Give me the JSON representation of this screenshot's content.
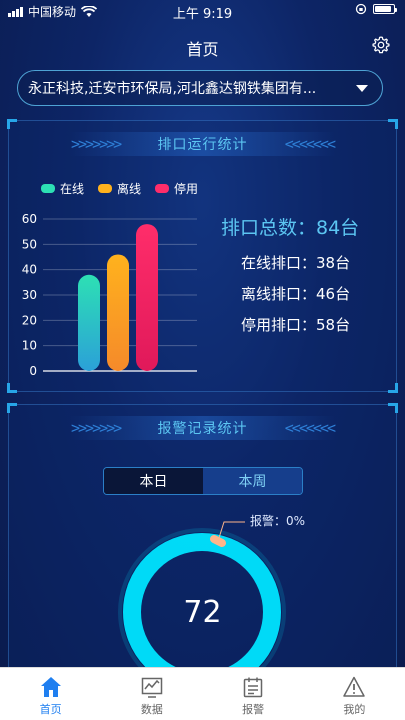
{
  "status_bar": {
    "carrier": "中国移动",
    "time": "上午 9:19"
  },
  "header": {
    "title": "首页"
  },
  "icons": {
    "settings": "gear-icon",
    "dropdown": "caret-down-icon"
  },
  "selector": {
    "value": "永正科技,迁安市环保局,河北鑫达钢铁集团有..."
  },
  "outlet_panel": {
    "title": "排口运行统计",
    "total_label": "排口总数：84台",
    "online_label": "在线排口：38台",
    "offline_label": "离线排口：46台",
    "stopped_label": "停用排口：58台"
  },
  "chart_data": {
    "type": "bar",
    "categories": [
      "在线",
      "离线",
      "停用"
    ],
    "series": [
      {
        "name": "在线",
        "values": [
          38
        ]
      },
      {
        "name": "离线",
        "values": [
          46
        ]
      },
      {
        "name": "停用",
        "values": [
          58
        ]
      }
    ],
    "values": [
      38,
      46,
      58
    ],
    "yticks": [
      "0",
      "10",
      "20",
      "30",
      "40",
      "50",
      "60"
    ],
    "ylim": [
      0,
      60
    ],
    "legend_position": "top-left",
    "colors": [
      "#2de0b4",
      "#ffb21d",
      "#ff2d6a"
    ],
    "gradient_ends": [
      "#2ba0d8",
      "#f58a2a",
      "#e0195a"
    ]
  },
  "alarm_panel": {
    "title": "报警记录统计",
    "tabs": [
      {
        "label": "本日",
        "active": true
      },
      {
        "label": "本周",
        "active": false
      }
    ],
    "ring_label": "报警：0%",
    "ring_value": "72"
  },
  "tabbar": {
    "items": [
      {
        "label": "首页",
        "icon": "home-icon",
        "active": true
      },
      {
        "label": "数据",
        "icon": "chart-icon",
        "active": false
      },
      {
        "label": "报警",
        "icon": "calendar-icon",
        "active": false
      },
      {
        "label": "我的",
        "icon": "warning-icon",
        "active": false
      }
    ]
  },
  "accent_colors": {
    "primary": "#5cc6f2",
    "ring": "#00e5ff",
    "tab_active": "#1f7ff0"
  }
}
